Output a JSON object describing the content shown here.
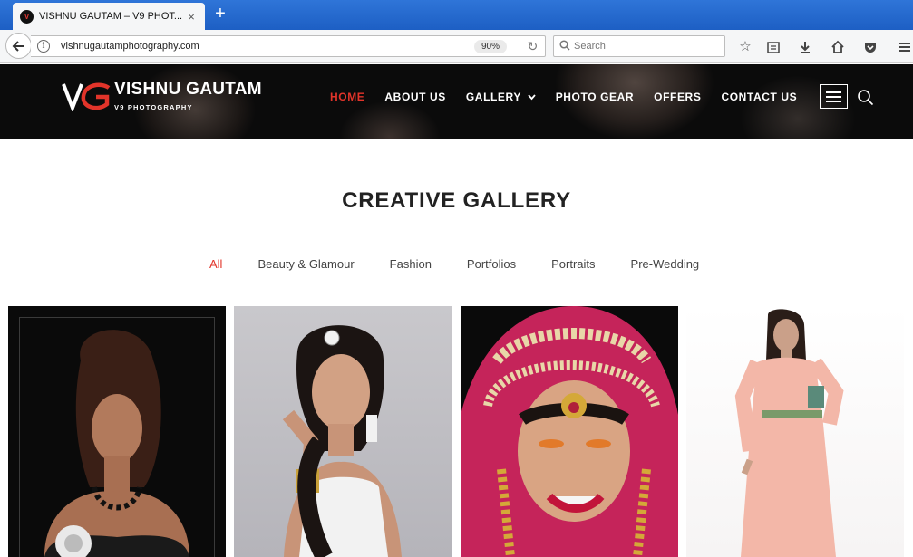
{
  "browser": {
    "tab_title": "VISHNU GAUTAM – V9 PHOT...",
    "tab_close": "×",
    "new_tab": "+",
    "url": "vishnugautamphotography.com",
    "zoom": "90%",
    "search_placeholder": "Search"
  },
  "site": {
    "logo_title": "VISHNU GAUTAM",
    "logo_subtitle": "V9 PHOTOGRAPHY",
    "accent_color": "#e2342a",
    "menu": [
      {
        "label": "HOME"
      },
      {
        "label": "ABOUT US"
      },
      {
        "label": "GALLERY"
      },
      {
        "label": "PHOTO GEAR"
      },
      {
        "label": "OFFERS"
      },
      {
        "label": "CONTACT US"
      }
    ]
  },
  "gallery": {
    "title": "CREATIVE GALLERY",
    "filters": [
      {
        "label": "All"
      },
      {
        "label": "Beauty & Glamour"
      },
      {
        "label": "Fashion"
      },
      {
        "label": "Portfolios"
      },
      {
        "label": "Portraits"
      },
      {
        "label": "Pre-Wedding"
      }
    ]
  }
}
